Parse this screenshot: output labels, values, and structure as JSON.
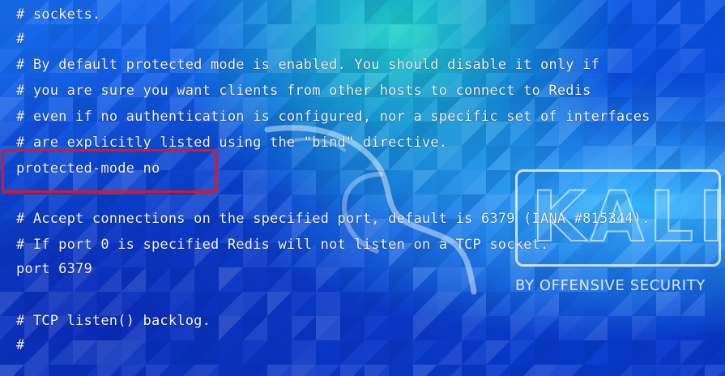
{
  "terminal": {
    "lines": [
      "# sockets.",
      "#",
      "# By default protected mode is enabled. You should disable it only if",
      "# you are sure you want clients from other hosts to connect to Redis",
      "# even if no authentication is configured, nor a specific set of interfaces",
      "# are explicitly listed using the \"bind\" directive.",
      "protected-mode no",
      "",
      "# Accept connections on the specified port, default is 6379 (IANA #815344).",
      "# If port 0 is specified Redis will not listen on a TCP socket.",
      "port 6379",
      "",
      "# TCP listen() backlog.",
      "#"
    ],
    "text_color": "#f4f8ff",
    "highlight_color": "#e3141b"
  },
  "wallpaper": {
    "logo_text": "KALI",
    "tagline": "BY OFFENSIVE SECURITY",
    "accent_colors": [
      "#1fd1c8",
      "#0a4fe0",
      "#0836c8"
    ]
  }
}
